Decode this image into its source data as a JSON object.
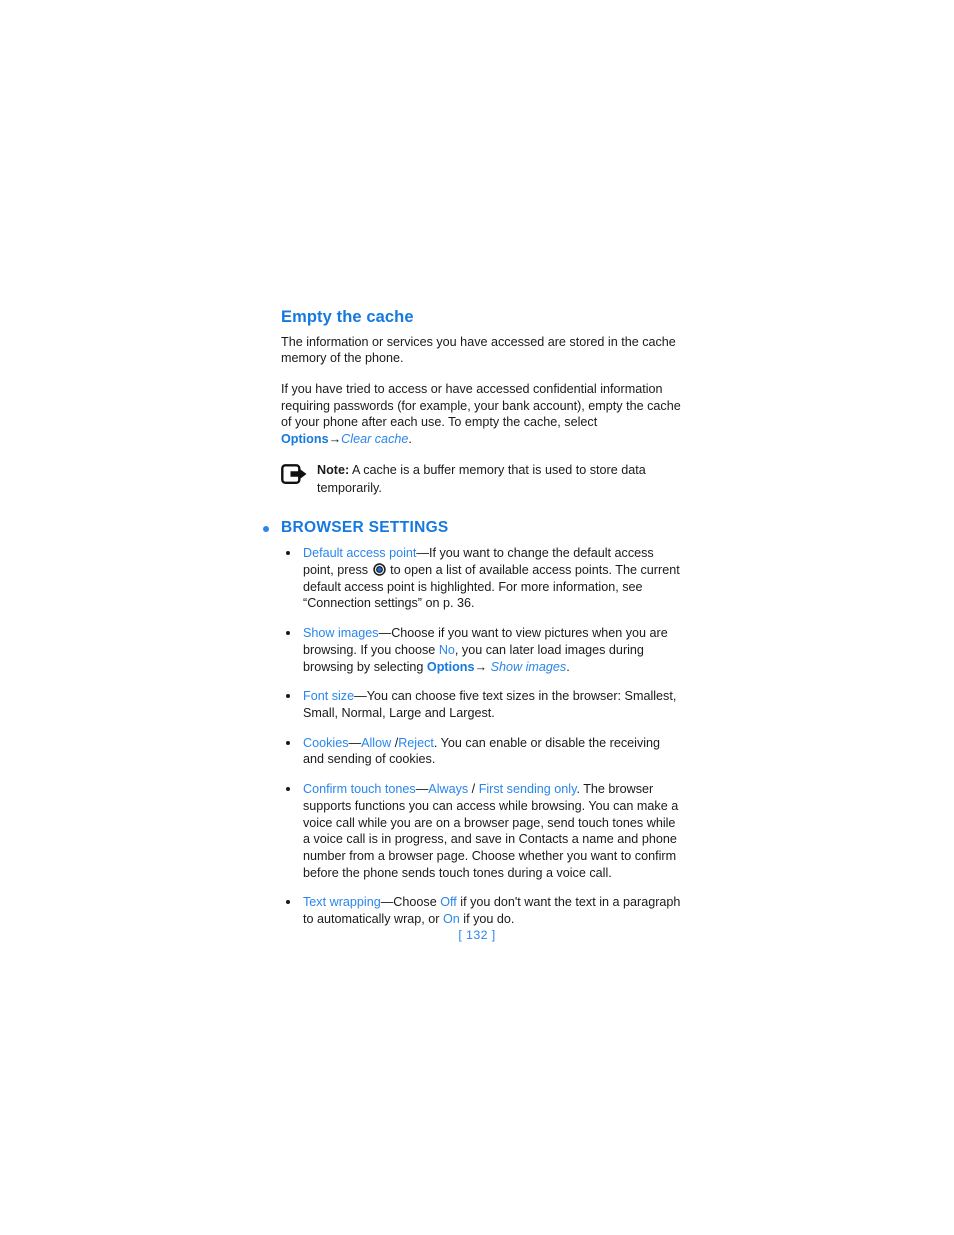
{
  "document": {
    "page_number_label": "[ 132 ]"
  },
  "sub_section": {
    "heading": "Empty the cache",
    "paragraph_1": "The information or services you have accessed are stored in the cache memory of the phone.",
    "paragraph_2": {
      "part_1": "If you have tried to access or have accessed confidential information requiring passwords (for example, your bank account), empty the cache of your phone after each use. To empty the cache, select ",
      "menu_options": "Options",
      "arrow": "→",
      "menu_item_italic": "Clear cache",
      "part_end": "."
    }
  },
  "note": {
    "icon_name": "note-arrow-icon",
    "label": "Note:",
    "text": " A cache is a buffer memory that is used to store data temporarily."
  },
  "section": {
    "heading": "BROWSER SETTINGS",
    "bullets": [
      {
        "name": "bullet-default-access-point",
        "segments": [
          {
            "text": "Default access point",
            "style": "blue"
          },
          {
            "text": "—If you want to change the default access point, press ",
            "style": "plain"
          },
          {
            "text": "",
            "style": "key-icon"
          },
          {
            "text": " to open a list of available access points. The current default access point is highlighted. For more information, see “Connection settings” on p. 36.",
            "style": "plain"
          }
        ]
      },
      {
        "name": "bullet-show-images",
        "segments": [
          {
            "text": "Show images",
            "style": "blue"
          },
          {
            "text": "—Choose if you want to view pictures when you are browsing. If you choose ",
            "style": "plain"
          },
          {
            "text": "No",
            "style": "blue"
          },
          {
            "text": ", you can later load images during browsing by selecting ",
            "style": "plain"
          },
          {
            "text": "Options",
            "style": "blue-bold"
          },
          {
            "text": "→ ",
            "style": "plain"
          },
          {
            "text": "Show images",
            "style": "blue-italic"
          },
          {
            "text": ".",
            "style": "plain"
          }
        ]
      },
      {
        "name": "bullet-font-size",
        "segments": [
          {
            "text": "Font size",
            "style": "blue"
          },
          {
            "text": "—You can choose five text sizes in the browser: Smallest, Small, Normal, Large and Largest.",
            "style": "plain"
          }
        ]
      },
      {
        "name": "bullet-cookies",
        "segments": [
          {
            "text": "Cookies",
            "style": "blue"
          },
          {
            "text": "—",
            "style": "plain"
          },
          {
            "text": "Allow",
            "style": "blue"
          },
          {
            "text": " /",
            "style": "plain"
          },
          {
            "text": "Reject",
            "style": "blue"
          },
          {
            "text": ". You can enable or disable the receiving and sending of cookies.",
            "style": "plain"
          }
        ]
      },
      {
        "name": "bullet-confirm-touch-tones",
        "segments": [
          {
            "text": "Confirm touch tones",
            "style": "blue"
          },
          {
            "text": "—",
            "style": "plain"
          },
          {
            "text": "Always",
            "style": "blue"
          },
          {
            "text": " / ",
            "style": "plain"
          },
          {
            "text": "First sending only",
            "style": "blue"
          },
          {
            "text": ". The browser supports functions you can access while browsing. You can make a voice call while you are on a browser page, send touch tones while a voice call is in progress, and save in Contacts a name and phone number from a browser page. Choose whether you want to confirm before the phone sends touch tones during a voice call.",
            "style": "plain"
          }
        ]
      },
      {
        "name": "bullet-text-wrapping",
        "segments": [
          {
            "text": "Text wrapping",
            "style": "blue"
          },
          {
            "text": "—Choose ",
            "style": "plain"
          },
          {
            "text": "Off",
            "style": "blue"
          },
          {
            "text": " if you don't want the text in a paragraph to automatically wrap, or ",
            "style": "plain"
          },
          {
            "text": "On",
            "style": "blue"
          },
          {
            "text": " if you do.",
            "style": "plain"
          }
        ]
      }
    ]
  },
  "colors": {
    "accent_blue": "#2a86ec",
    "heading_blue": "#1579e0",
    "body_black": "#1a1a1a"
  }
}
